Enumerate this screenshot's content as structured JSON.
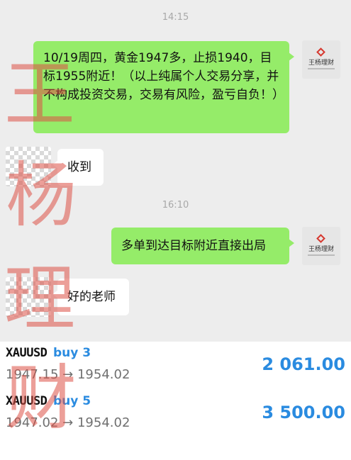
{
  "chat": {
    "timestamps": [
      "14:15",
      "16:10"
    ],
    "messages": [
      {
        "side": "out",
        "text": "10/19周四，黄金1947多，止损1940，目标1955附近！（以上纯属个人交易分享，并不构成投资交易，交易有风险，盈亏自负！）"
      },
      {
        "side": "in",
        "text": "收到"
      },
      {
        "side": "out",
        "text": "多单到达目标附近直接出局"
      },
      {
        "side": "in",
        "text": "好的老师"
      }
    ],
    "sender_avatar_text": "王杨理财"
  },
  "trades": [
    {
      "symbol": "XAUUSD",
      "side": "buy 3",
      "prices": "1947.15 → 1954.02",
      "profit": "2 061.00"
    },
    {
      "symbol": "XAUUSD",
      "side": "buy 5",
      "prices": "1947.02 → 1954.02",
      "profit": "3 500.00"
    }
  ],
  "watermark": [
    "王",
    "杨",
    "理",
    "财"
  ],
  "colors": {
    "chat_background": "#ededed",
    "outgoing_bubble": "#95ec69",
    "incoming_bubble": "#ffffff",
    "profit": "#2a8be0",
    "watermark": "#dc5046"
  }
}
